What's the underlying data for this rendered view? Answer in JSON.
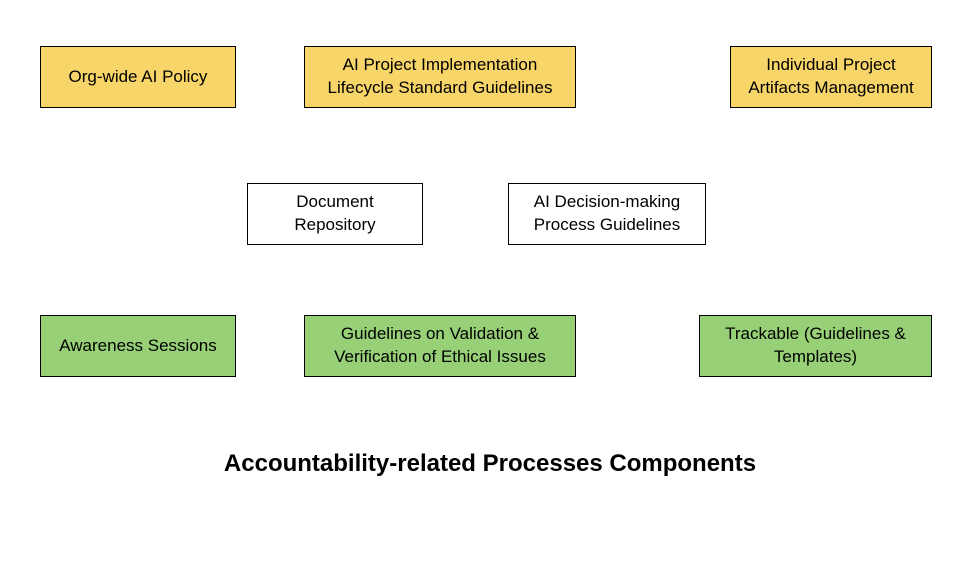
{
  "title": "Accountability-related Processes Components",
  "boxes": {
    "row1": {
      "a": "Org-wide AI Policy",
      "b": "AI Project Implementation Lifecycle Standard Guidelines",
      "c": "Individual Project Artifacts Management"
    },
    "row2": {
      "a": "Document Repository",
      "b": "AI Decision-making Process Guidelines"
    },
    "row3": {
      "a": "Awareness Sessions",
      "b": "Guidelines on Validation & Verification of Ethical Issues",
      "c": "Trackable (Guidelines & Templates)"
    }
  },
  "colors": {
    "yellow": "#f8d568",
    "green": "#97d077",
    "white": "#ffffff"
  }
}
